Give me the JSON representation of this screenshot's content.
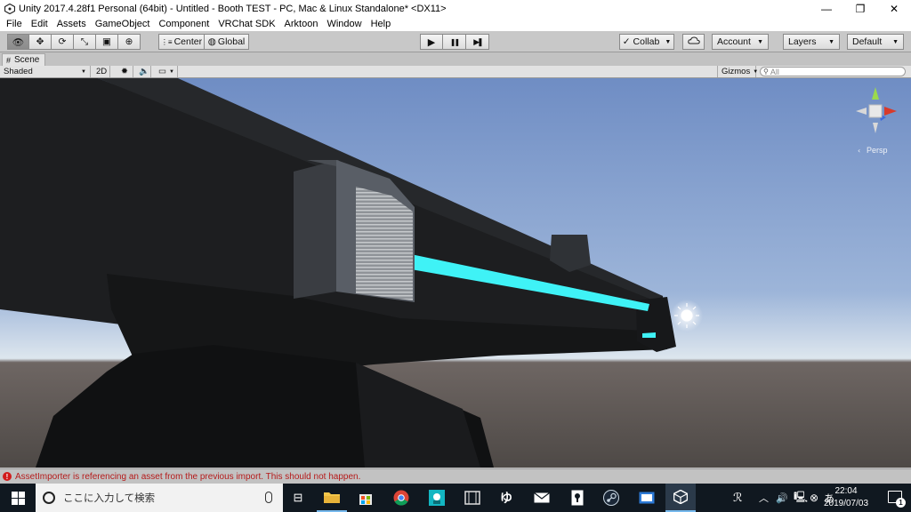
{
  "window": {
    "title": "Unity 2017.4.28f1 Personal (64bit) - Untitled - Booth TEST - PC, Mac & Linux Standalone* <DX11>",
    "controls": {
      "minimize": "—",
      "restore": "❐",
      "close": "✕"
    }
  },
  "menu": [
    "File",
    "Edit",
    "Assets",
    "GameObject",
    "Component",
    "VRChat SDK",
    "Arktoon",
    "Window",
    "Help"
  ],
  "toolbar": {
    "tools": [
      {
        "name": "view-tool",
        "icon": "eye-icon",
        "glyph": "👁"
      },
      {
        "name": "move-tool",
        "icon": "move-arrows-icon",
        "glyph": "✥"
      },
      {
        "name": "rotate-tool",
        "icon": "rotate-icon",
        "glyph": "⟳"
      },
      {
        "name": "scale-tool",
        "icon": "scale-icon",
        "glyph": "⤡"
      },
      {
        "name": "rect-tool",
        "icon": "rect-icon",
        "glyph": "▣"
      },
      {
        "name": "transform-tool",
        "icon": "transform-icon",
        "glyph": "⊕"
      }
    ],
    "pivot": {
      "center_label": "Center",
      "global_label": "Global"
    },
    "play": {
      "play": "▶",
      "pause": "❚❚",
      "step": "▶❚"
    },
    "collab_label": "Collab",
    "cloud_icon": "cloud-icon",
    "account_label": "Account",
    "layers_label": "Layers",
    "layout_label": "Default"
  },
  "scene_tab": {
    "label": "Scene"
  },
  "scene_bar": {
    "shading": "Shaded",
    "mode_2d": "2D",
    "gizmos": "Gizmos",
    "search_placeholder": "All"
  },
  "viewport": {
    "persp_label": "Persp",
    "sky_top": "#7b97c9",
    "sky_bottom": "#dde6ee",
    "ground": "#5b5552",
    "glow_color": "#3ff2f6"
  },
  "status": {
    "message": "AssetImporter is referencing an asset from the previous import. This should not happen."
  },
  "taskbar": {
    "search_placeholder": "ここに入力して検索",
    "time": "22:04",
    "date": "2019/07/03",
    "ime": "あ",
    "notif_count": "1"
  }
}
